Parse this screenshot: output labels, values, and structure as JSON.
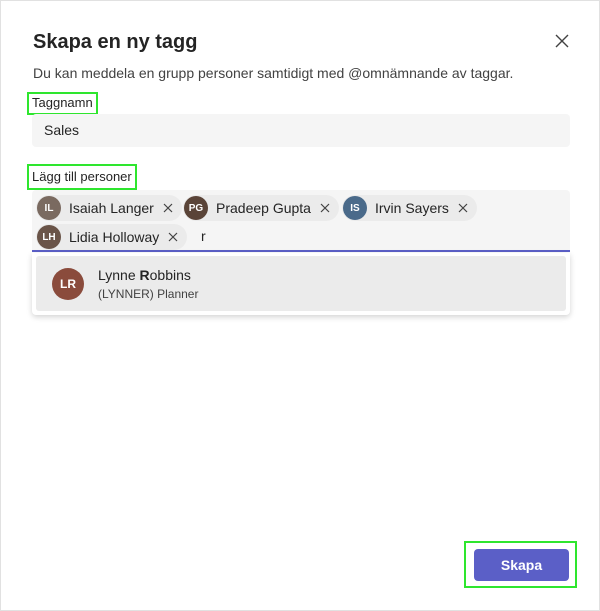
{
  "dialog": {
    "title": "Skapa en ny tagg",
    "description": "Du kan meddela en grupp personer samtidigt med @omnämnande av taggar."
  },
  "tag_field": {
    "label": "Taggnamn",
    "value": "Sales"
  },
  "people_field": {
    "label": "Lägg till personer",
    "selected": [
      {
        "name": "Isaiah Langer",
        "initials": "IL",
        "color": "#7a6a60"
      },
      {
        "name": "Pradeep Gupta",
        "initials": "PG",
        "color": "#5a4438"
      },
      {
        "name": "Irvin Sayers",
        "initials": "IS",
        "color": "#4a6a8a"
      },
      {
        "name": "Lidia Holloway",
        "initials": "LH",
        "color": "#6a5448"
      }
    ],
    "typed_text": "r"
  },
  "suggestion": {
    "name_prefix": "Lynne ",
    "name_match": "R",
    "name_suffix": "obbins",
    "subtitle": "(LYNNER) Planner",
    "initials": "LR"
  },
  "actions": {
    "create_label": "Skapa"
  },
  "colors": {
    "accent": "#5b5fc7",
    "highlight": "#2ee62e"
  }
}
